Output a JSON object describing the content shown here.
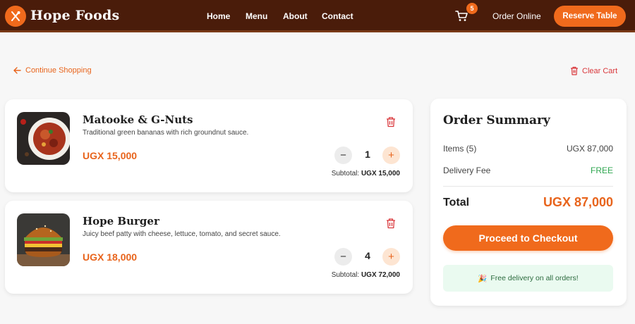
{
  "header": {
    "brand": "Hope Foods",
    "nav": [
      "Home",
      "Menu",
      "About",
      "Contact"
    ],
    "cart_count": "5",
    "order_online": "Order Online",
    "reserve": "Reserve Table"
  },
  "links": {
    "continue": "Continue Shopping",
    "clear": "Clear Cart"
  },
  "items": [
    {
      "name": "Matooke & G-Nuts",
      "description": "Traditional green bananas with rich groundnut sauce.",
      "price": "UGX 15,000",
      "quantity": "1",
      "subtotal_label": "Subtotal:",
      "subtotal": "UGX 15,000"
    },
    {
      "name": "Hope Burger",
      "description": "Juicy beef patty with cheese, lettuce, tomato, and secret sauce.",
      "price": "UGX 18,000",
      "quantity": "4",
      "subtotal_label": "Subtotal:",
      "subtotal": "UGX 72,000"
    }
  ],
  "summary": {
    "title": "Order Summary",
    "items_label": "Items (5)",
    "items_value": "UGX 87,000",
    "delivery_label": "Delivery Fee",
    "delivery_value": "FREE",
    "total_label": "Total",
    "total_value": "UGX 87,000",
    "checkout": "Proceed to Checkout",
    "free_note": "Free delivery on all orders!"
  },
  "colors": {
    "header_bg": "#4a1c0a",
    "accent": "#f06a1c",
    "price": "#e8641c",
    "danger": "#d9373b",
    "free": "#2ea64f"
  }
}
